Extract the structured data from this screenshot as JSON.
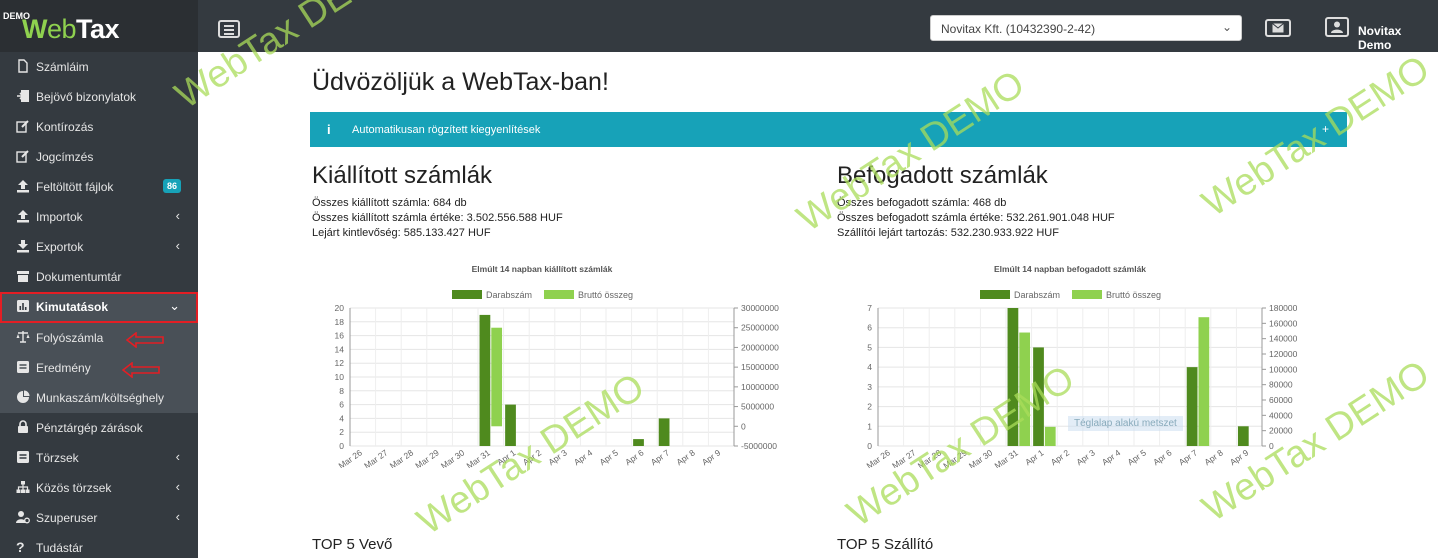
{
  "topbar": {
    "demo_label": "DEMO",
    "brand_w": "W",
    "brand_eb": "eb",
    "brand_tax": "Tax",
    "company": "Novitax Kft. (10432390-2-42)",
    "user": "Novitax Demo"
  },
  "sidebar": {
    "items": [
      {
        "label": "Számláim",
        "icon": "file-icon"
      },
      {
        "label": "Bejövő bizonylatok",
        "icon": "inbox-icon"
      },
      {
        "label": "Kontírozás",
        "icon": "edit-icon"
      },
      {
        "label": "Jogcímzés",
        "icon": "edit-icon"
      },
      {
        "label": "Feltöltött fájlok",
        "icon": "upload-icon",
        "badge": "86"
      },
      {
        "label": "Importok",
        "icon": "upload-icon"
      },
      {
        "label": "Exportok",
        "icon": "download-icon"
      },
      {
        "label": "Dokumentumtár",
        "icon": "archive-icon"
      },
      {
        "label": "Kimutatások",
        "icon": "chart-icon"
      },
      {
        "label": "Folyószámla",
        "icon": "balance-icon"
      },
      {
        "label": "Eredmény",
        "icon": "list-icon"
      },
      {
        "label": "Munkaszám/költséghely",
        "icon": "pie-icon"
      },
      {
        "label": "Pénztárgép zárások",
        "icon": "lock-icon"
      },
      {
        "label": "Törzsek",
        "icon": "list-icon"
      },
      {
        "label": "Közös törzsek",
        "icon": "sitemap-icon"
      },
      {
        "label": "Szuperuser",
        "icon": "user-cog-icon"
      },
      {
        "label": "Tudástár",
        "icon": "question-icon"
      }
    ]
  },
  "main": {
    "title": "Üdvözöljük a WebTax-ban!",
    "alert": {
      "icon": "i",
      "text": "Automatikusan rögzített kiegyenlítések",
      "toggle": "+"
    },
    "issued": {
      "title": "Kiállított számlák",
      "count": "Összes kiállított számla: 684 db",
      "value": "Összes kiállított számla értéke: 3.502.556.588 HUF",
      "overdue": "Lejárt kintlevőség: 585.133.427 HUF"
    },
    "received": {
      "title": "Befogadott számlák",
      "count": "Összes befogadott számla: 468 db",
      "value": "Összes befogadott számla értéke: 532.261.901.048 HUF",
      "overdue": "Szállítói lejárt tartozás: 532.230.933.922 HUF"
    },
    "top5_customer": "TOP 5 Vevő",
    "top5_supplier": "TOP 5 Szállító",
    "watermark": "WebTax DEMO",
    "tooltip_fragment": "Téglalap alakú metszet"
  },
  "colors": {
    "dark": "#4f8a1e",
    "light": "#8fd14f",
    "sidebar": "#343a40",
    "alert": "#17a2b8"
  },
  "chart_data": [
    {
      "type": "bar",
      "title": "Elmúlt 14 napban kiállított számlák",
      "categories": [
        "Mar 26",
        "Mar 27",
        "Mar 28",
        "Mar 29",
        "Mar 30",
        "Mar 31",
        "Apr 1",
        "Apr 2",
        "Apr 3",
        "Apr 4",
        "Apr 5",
        "Apr 6",
        "Apr 7",
        "Apr 8",
        "Apr 9"
      ],
      "series": [
        {
          "name": "Darabszám",
          "axis": "left",
          "values": [
            0,
            0,
            0,
            0,
            0,
            19,
            6,
            0,
            0,
            0,
            0,
            1,
            4,
            0,
            0
          ]
        },
        {
          "name": "Bruttó összeg",
          "axis": "right",
          "values": [
            0,
            0,
            0,
            0,
            0,
            25000000,
            0,
            0,
            0,
            0,
            0,
            0,
            0,
            0,
            0
          ]
        }
      ],
      "y_left": {
        "min": 0,
        "max": 20,
        "ticks": [
          "0",
          "2",
          "4",
          "6",
          "8",
          "10",
          "12",
          "14",
          "16",
          "18",
          "20"
        ]
      },
      "y_right": {
        "min": -5000000,
        "max": 30000000,
        "ticks": [
          "-5000000",
          "0",
          "5000000",
          "10000000",
          "15000000",
          "20000000",
          "25000000",
          "30000000"
        ]
      },
      "grid": true,
      "legend": "top"
    },
    {
      "type": "bar",
      "title": "Elmúlt 14 napban befogadott számlák",
      "categories": [
        "Mar 26",
        "Mar 27",
        "Mar 28",
        "Mar 29",
        "Mar 30",
        "Mar 31",
        "Apr 1",
        "Apr 2",
        "Apr 3",
        "Apr 4",
        "Apr 5",
        "Apr 6",
        "Apr 7",
        "Apr 8",
        "Apr 9"
      ],
      "series": [
        {
          "name": "Darabszám",
          "axis": "left",
          "values": [
            0,
            0,
            0,
            0,
            0,
            7,
            5,
            0,
            0,
            0,
            0,
            0,
            4,
            0,
            1
          ]
        },
        {
          "name": "Bruttó összeg",
          "axis": "right",
          "values": [
            0,
            0,
            0,
            0,
            0,
            148000,
            25000,
            0,
            0,
            0,
            0,
            0,
            168000,
            0,
            0
          ]
        }
      ],
      "y_left": {
        "min": 0,
        "max": 7,
        "ticks": [
          "0",
          "1",
          "2",
          "3",
          "4",
          "5",
          "6",
          "7"
        ]
      },
      "y_right": {
        "min": 0,
        "max": 180000,
        "ticks": [
          "0",
          "20000",
          "40000",
          "60000",
          "80000",
          "100000",
          "120000",
          "140000",
          "160000",
          "180000"
        ]
      },
      "grid": true,
      "legend": "top"
    }
  ]
}
